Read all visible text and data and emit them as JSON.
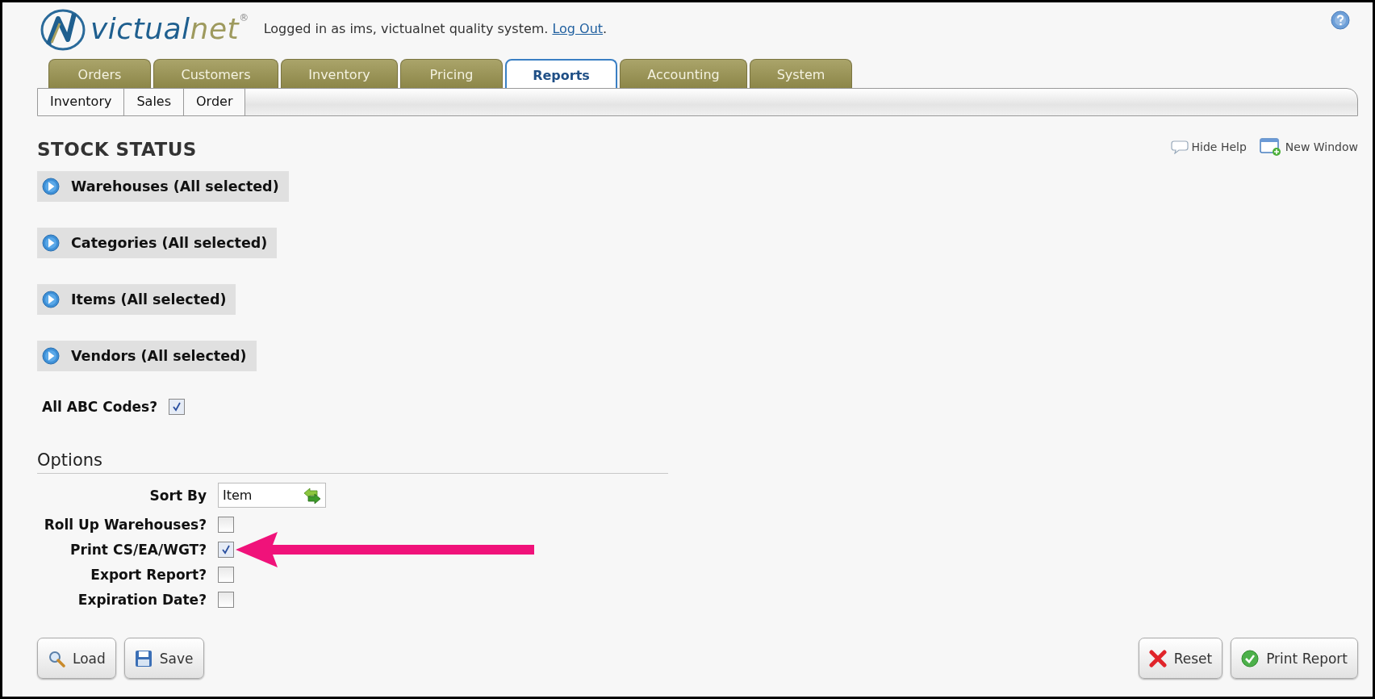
{
  "header": {
    "logo": {
      "part1": "victual",
      "part2": "net",
      "mark": "®"
    },
    "login_prefix": "Logged in as ims, victualnet quality system.",
    "logout_link": "Log Out",
    "login_suffix": "."
  },
  "tabs": [
    {
      "label": "Orders",
      "selected": false
    },
    {
      "label": "Customers",
      "selected": false
    },
    {
      "label": "Inventory",
      "selected": false
    },
    {
      "label": "Pricing",
      "selected": false
    },
    {
      "label": "Reports",
      "selected": true
    },
    {
      "label": "Accounting",
      "selected": false
    },
    {
      "label": "System",
      "selected": false
    }
  ],
  "subtabs": [
    "Inventory",
    "Sales",
    "Order"
  ],
  "page_title": "STOCK STATUS",
  "page_links": [
    {
      "kind": "help",
      "label": "Hide Help"
    },
    {
      "kind": "window",
      "label": "New Window"
    }
  ],
  "sections": [
    {
      "label": "Warehouses (All selected)",
      "expanded": false
    },
    {
      "label": "Categories (All selected)",
      "expanded": false
    },
    {
      "label": "Items (All selected)",
      "expanded": false
    },
    {
      "label": "Vendors (All selected)",
      "expanded": false
    }
  ],
  "all_abc": {
    "label": "All ABC Codes?",
    "checked": true
  },
  "options": {
    "title": "Options",
    "sort_by": {
      "label": "Sort By",
      "value": "Item"
    },
    "checkboxes": [
      {
        "label": "Roll Up Warehouses?",
        "checked": false,
        "highlighted": false
      },
      {
        "label": "Print CS/EA/WGT?",
        "checked": true,
        "highlighted": true
      },
      {
        "label": "Export Report?",
        "checked": false,
        "highlighted": false
      },
      {
        "label": "Expiration Date?",
        "checked": false,
        "highlighted": false
      }
    ]
  },
  "buttons_left": [
    {
      "kind": "load",
      "label": "Load"
    },
    {
      "kind": "save",
      "label": "Save"
    }
  ],
  "buttons_right": [
    {
      "kind": "reset",
      "label": "Reset"
    },
    {
      "kind": "print",
      "label": "Print Report"
    }
  ]
}
